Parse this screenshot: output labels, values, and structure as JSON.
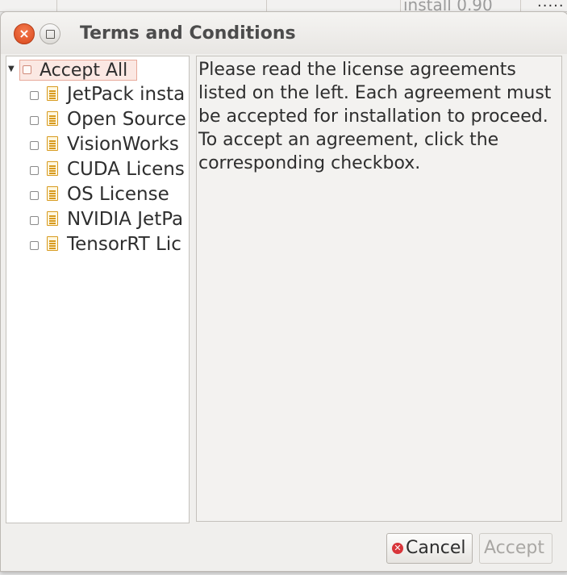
{
  "background": {
    "install_text": "install 0.90",
    "dots": "....."
  },
  "dialog": {
    "title": "Terms and Conditions",
    "close_glyph": "×",
    "accept_all": "Accept All",
    "items": [
      {
        "label": "JetPack insta"
      },
      {
        "label": "Open Source"
      },
      {
        "label": "VisionWorks"
      },
      {
        "label": "CUDA Licens"
      },
      {
        "label": "OS License"
      },
      {
        "label": "NVIDIA JetPa"
      },
      {
        "label": "TensorRT Lic"
      }
    ],
    "instructions": "Please read the license agreements listed on the left. Each agreement must be accepted for installation to proceed. To accept an agreement, click the corresponding checkbox.",
    "buttons": {
      "cancel": "Cancel",
      "accept": "Accept"
    }
  },
  "colors": {
    "close_button": "#d9481c",
    "selection_bg": "#fbe8e3",
    "doc_icon": "#d79a1e",
    "cancel_icon": "#d8353a"
  }
}
